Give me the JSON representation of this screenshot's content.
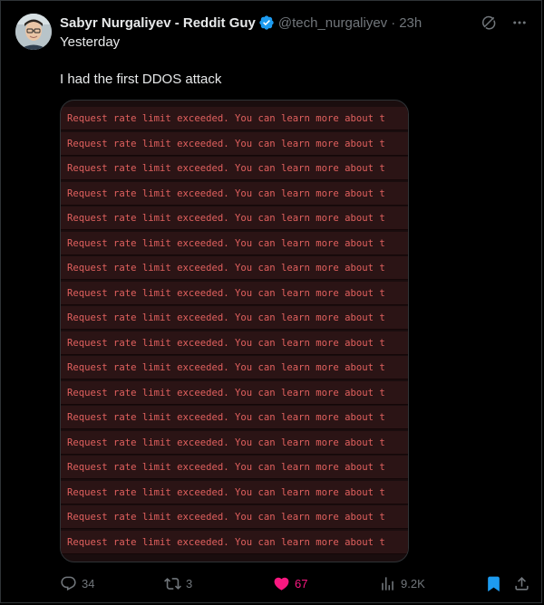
{
  "author": {
    "name": "Sabyr Nurgaliyev - Reddit Guy",
    "handle": "@tech_nurgaliyev",
    "separator": "·",
    "time": "23h"
  },
  "subline": "Yesterday",
  "text": "I had the first DDOS attack",
  "media": {
    "line_text": "Request rate limit exceeded. You can learn more about t",
    "lines": 18
  },
  "stats": {
    "replies": "34",
    "reposts": "3",
    "likes": "67",
    "views": "9.2K"
  },
  "colors": {
    "background": "#000000",
    "text": "#e7e9ea",
    "muted": "#71767b",
    "accent": "#1d9bf0",
    "like": "#f91880",
    "error_text": "#e0605e"
  },
  "icons": {
    "verified": "verified-badge-icon",
    "grok": "grok-icon",
    "more": "more-icon",
    "reply": "reply-icon",
    "repost": "repost-icon",
    "like": "heart-icon",
    "views": "views-icon",
    "bookmark": "bookmark-icon",
    "share": "share-icon"
  }
}
